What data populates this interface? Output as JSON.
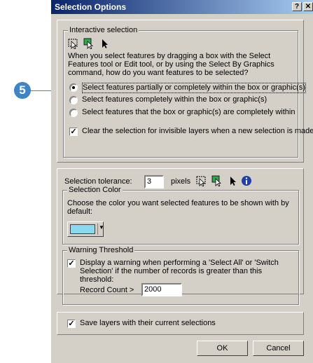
{
  "callout": "5",
  "window": {
    "title": "Selection Options",
    "help_glyph": "?",
    "close_glyph": "✕"
  },
  "interactive": {
    "legend": "Interactive selection",
    "description": "When you select features by dragging a box with the Select Features tool or Edit tool, or by using the Select By Graphics command, how do you want features to be selected?",
    "options": [
      {
        "label": "Select features partially or completely within the box or graphic(s)",
        "selected": true
      },
      {
        "label": "Select features completely within the box or graphic(s)",
        "selected": false
      },
      {
        "label": "Select features that the box or graphic(s) are completely within",
        "selected": false
      }
    ],
    "clear_label": "Clear the selection for invisible layers when a new selection is made",
    "clear_checked": true
  },
  "tolerance": {
    "label": "Selection tolerance:",
    "value": "3",
    "units": "pixels"
  },
  "color": {
    "legend": "Selection Color",
    "description": "Choose the color you want selected features to be shown with by default:",
    "swatch": "#8fd6f0"
  },
  "warning": {
    "legend": "Warning Threshold",
    "check_label": "Display a warning when performing a 'Select All' or 'Switch Selection' if the number of records is greater than this threshold:",
    "checked": true,
    "count_label": "Record Count >",
    "count_value": "2000"
  },
  "save": {
    "label": "Save layers with their current selections",
    "checked": true
  },
  "buttons": {
    "ok": "OK",
    "cancel": "Cancel"
  },
  "icons": [
    "select-features-icon",
    "select-by-graphics-icon",
    "edit-tool-icon",
    "info-icon"
  ],
  "colors": {
    "dialog": "#d4d0c8",
    "titlebar": "#0a246a",
    "callout": "#3f84c5"
  }
}
